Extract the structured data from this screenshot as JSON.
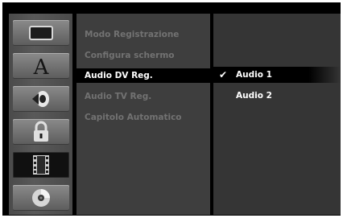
{
  "icon_sidebar": {
    "items": [
      {
        "icon": "screen-rectangle-icon",
        "selected": false
      },
      {
        "icon": "letter-a-language-icon",
        "selected": false
      },
      {
        "icon": "speaker-audio-icon",
        "selected": false
      },
      {
        "icon": "padlock-icon",
        "selected": false
      },
      {
        "icon": "film-strip-icon",
        "selected": true
      },
      {
        "icon": "disc-icon",
        "selected": false
      }
    ]
  },
  "menu": {
    "items": [
      {
        "label": "Modo Registrazione"
      },
      {
        "label": "Configura schermo"
      },
      {
        "label": "Audio DV Reg."
      },
      {
        "label": "Audio TV Reg."
      },
      {
        "label": "Capitolo Automatico"
      }
    ],
    "active_label": "Audio DV Reg."
  },
  "options": {
    "items": [
      {
        "label": "Audio 1",
        "checked": true
      },
      {
        "label": "Audio 2",
        "checked": false
      }
    ],
    "check_symbol": "✔"
  },
  "colors": {
    "background": "#000000",
    "menu_panel": "#3e3e3e",
    "options_panel": "#353535",
    "dim_text": "#727272",
    "highlight_text": "#ffffff"
  }
}
